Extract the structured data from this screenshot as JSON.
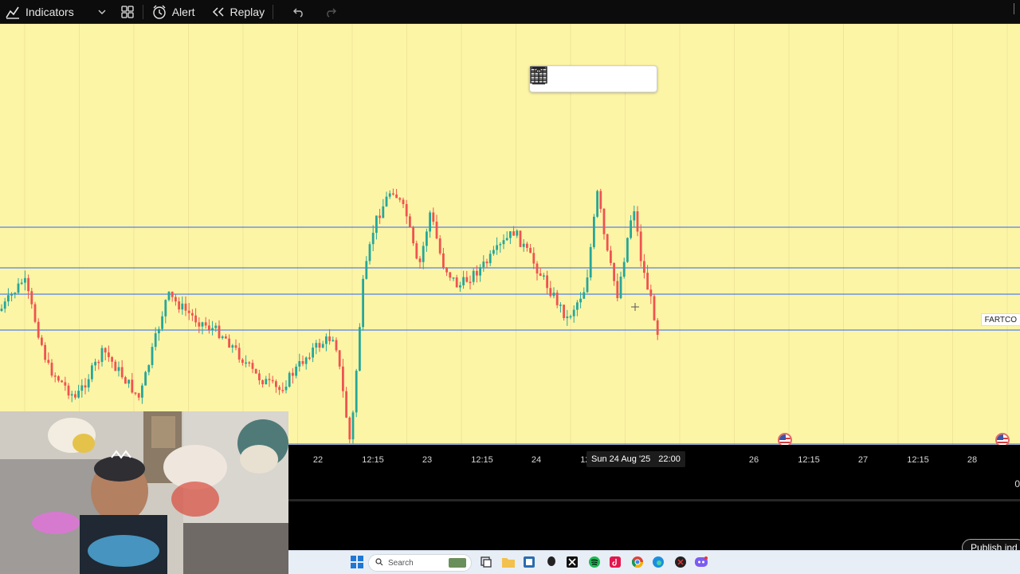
{
  "toolbar": {
    "indicators_label": "Indicators",
    "alert_label": "Alert",
    "replay_label": "Replay"
  },
  "chart": {
    "background_color": "#fdf5a6",
    "up_color": "#26a69a",
    "down_color": "#ef5350",
    "line_color": "#2962ff",
    "symbol_label": "FARTCO",
    "horizontal_levels": 4
  },
  "time_axis": {
    "ticks": [
      "22",
      "12:15",
      "23",
      "12:15",
      "24",
      "12:15",
      "26",
      "12:15",
      "27",
      "12:15",
      "28"
    ],
    "crosshair_date": "Sun 24 Aug '25",
    "crosshair_time": "22:00"
  },
  "bottom_panel": {
    "value": "0",
    "publish_label": "Publish ind"
  },
  "taskbar": {
    "search_label": "Search"
  }
}
